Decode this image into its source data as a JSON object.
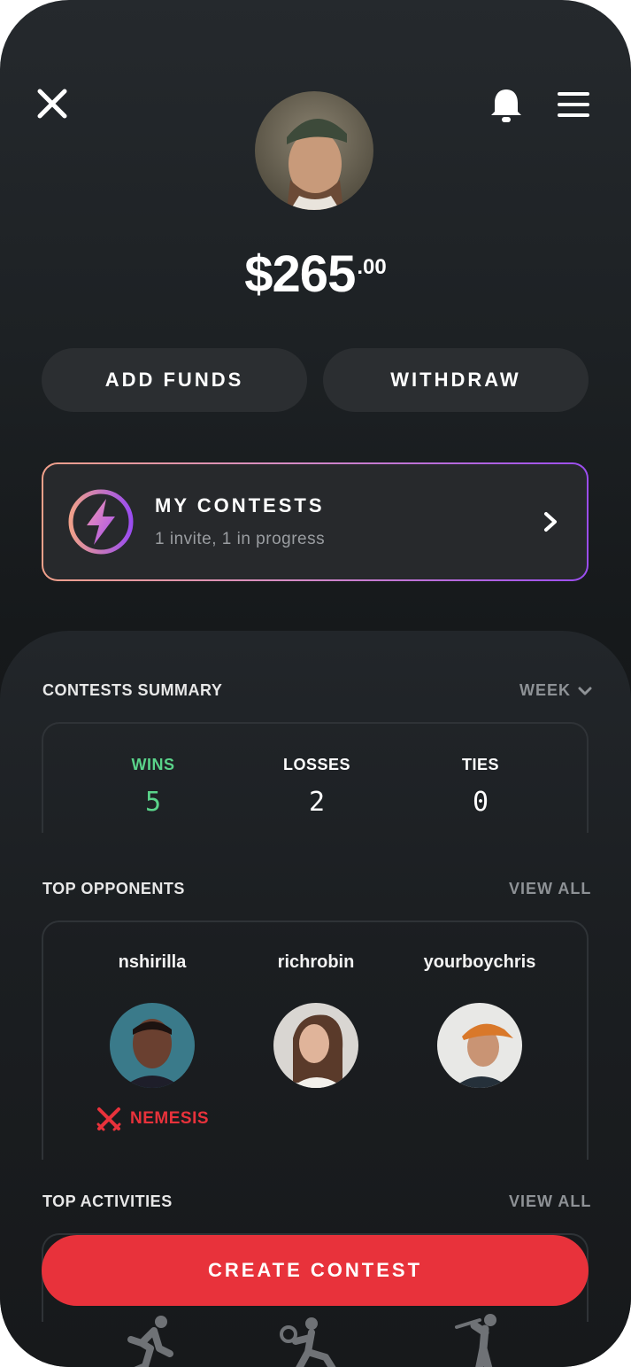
{
  "header": {
    "close_icon": "close-icon",
    "bell_icon": "bell-icon",
    "menu_icon": "hamburger-menu-icon"
  },
  "balance": {
    "whole": "$265",
    "cents": ".00"
  },
  "actions": {
    "add_funds": "ADD FUNDS",
    "withdraw": "WITHDRAW"
  },
  "my_contests": {
    "title": "MY CONTESTS",
    "subtitle": "1 invite, 1 in progress",
    "icon": "lightning-bolt-icon"
  },
  "summary": {
    "title": "CONTESTS SUMMARY",
    "period": "WEEK",
    "stats": [
      {
        "label": "WINS",
        "value": "5",
        "color": "#5ad38a"
      },
      {
        "label": "LOSSES",
        "value": "2",
        "color": "#ffffff"
      },
      {
        "label": "TIES",
        "value": "0",
        "color": "#ffffff"
      }
    ]
  },
  "opponents": {
    "title": "TOP OPPONENTS",
    "view_all": "VIEW ALL",
    "items": [
      {
        "name": "nshirilla",
        "badge": "NEMESIS"
      },
      {
        "name": "richrobin"
      },
      {
        "name": "yourboychris"
      }
    ]
  },
  "activities": {
    "title": "TOP ACTIVITIES",
    "view_all": "VIEW ALL",
    "icons": [
      "running-icon",
      "pickleball-icon",
      "golf-icon"
    ]
  },
  "create_button": "CREATE CONTEST",
  "colors": {
    "accent_red": "#e8323b",
    "win_green": "#5ad38a",
    "gradient_start": "#f0a08a",
    "gradient_end": "#9b4df0"
  }
}
